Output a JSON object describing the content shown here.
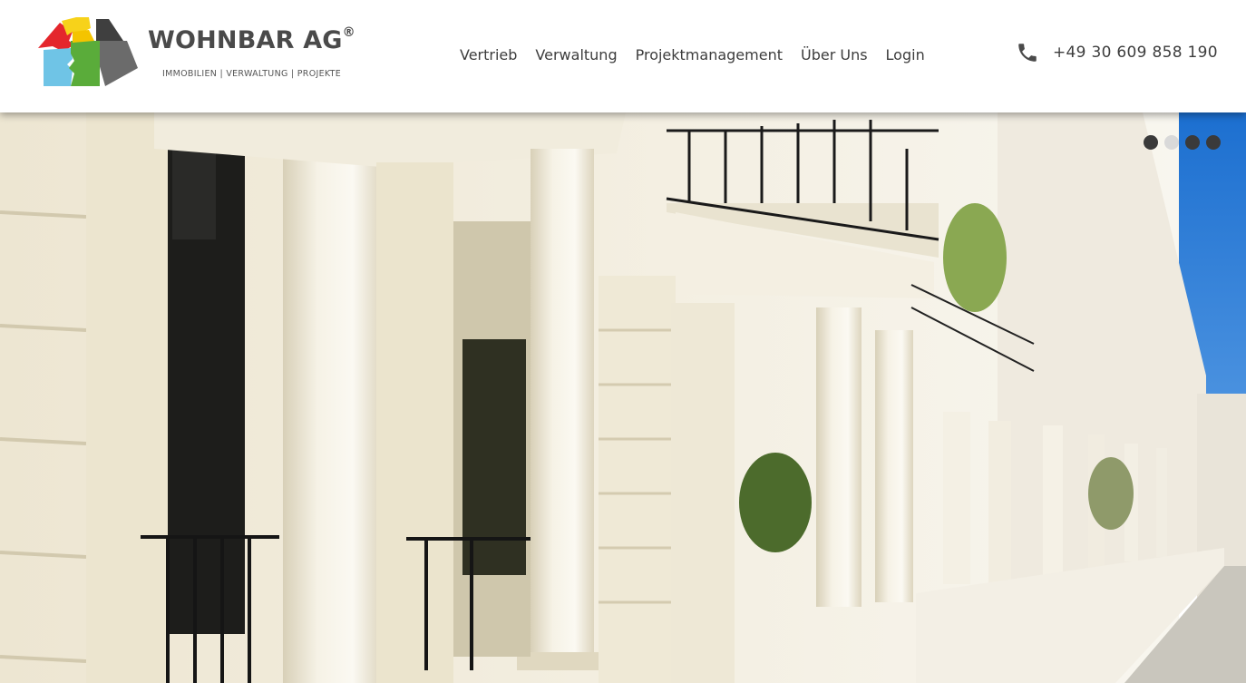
{
  "brand": {
    "name": "WOHNBAR AG",
    "registered_mark": "®",
    "tagline": "IMMOBILIEN | VERWALTUNG | PROJEKTE",
    "logo_icon": "puzzle-house-icon"
  },
  "nav": {
    "items": [
      {
        "label": "Vertrieb"
      },
      {
        "label": "Verwaltung"
      },
      {
        "label": "Projektmanagement"
      },
      {
        "label": "Über Uns"
      },
      {
        "label": "Login"
      }
    ]
  },
  "contact": {
    "phone_icon": "phone-icon",
    "phone": "+49 30 609 858 190"
  },
  "hero": {
    "image_subject": "white stucco terraced houses with columns and balconies",
    "slides": 4,
    "active_slide": 2
  },
  "colors": {
    "text": "#3d3d3d",
    "header_bg": "#ffffff",
    "dot_inactive": "#3a3a3a",
    "dot_active": "#d9d9d9",
    "logo_red": "#e4262c",
    "logo_yellow": "#f7d21a",
    "logo_blue": "#6fc4e6",
    "logo_green": "#5aac3a",
    "logo_grey": "#555555"
  }
}
